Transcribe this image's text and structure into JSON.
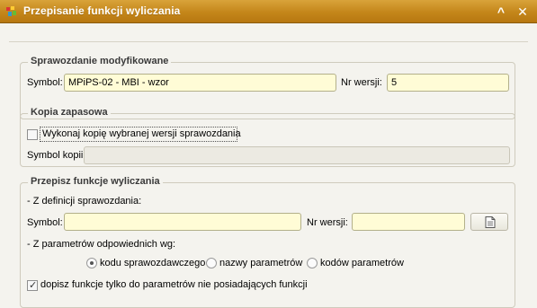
{
  "window": {
    "title": "Przepisanie funkcji wyliczania",
    "buttons": {
      "collapse": "^",
      "close": "✕"
    }
  },
  "sprawozdanie": {
    "legend": "Sprawozdanie modyfikowane",
    "symbol_label": "Symbol:",
    "symbol_value": "MPiPS-02 - MBI - wzor",
    "version_label": "Nr wersji:",
    "version_value": "5"
  },
  "kopia": {
    "legend": "Kopia zapasowa",
    "checkbox_label": "Wykonaj kopię wybranej wersji sprawozdania",
    "checkbox_checked": false,
    "symbol_label": "Symbol kopii:",
    "symbol_value": ""
  },
  "przepisz": {
    "legend": "Przepisz funkcje wyliczania",
    "from_definition_label": "- Z definicji sprawozdania:",
    "symbol_label": "Symbol:",
    "symbol_value": "",
    "version_label": "Nr wersji:",
    "version_value": "",
    "params_label": "- Z parametrów odpowiednich wg:",
    "radio_options": [
      "kodu sprawozdawczego",
      "nazwy parametrów",
      "kodów parametrów"
    ],
    "radio_selected": 0,
    "append_checkbox_label": "dopisz funkcje tylko do parametrów nie posiadających funkcji",
    "append_checkbox_checked": true
  },
  "colors": {
    "titlebar": "#c4861a",
    "input_bg": "#fffcd6",
    "panel_bg": "#f4f3ee"
  },
  "icons": [
    "app-icon",
    "collapse-icon",
    "close-icon",
    "document-icon"
  ]
}
